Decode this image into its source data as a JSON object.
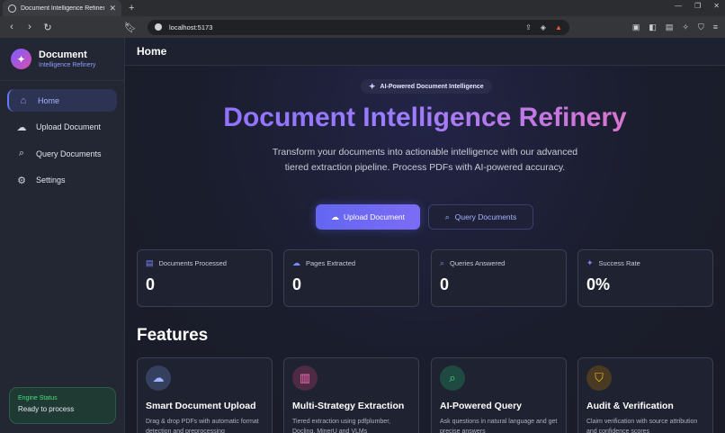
{
  "browser": {
    "tab_title": "Document Intelligence Refinery",
    "url": "localhost:5173"
  },
  "sidebar": {
    "brand_title": "Document",
    "brand_subtitle": "Intelligence Refinery",
    "items": [
      {
        "label": "Home",
        "icon": "home-icon",
        "active": true
      },
      {
        "label": "Upload Document",
        "icon": "cloud-upload-icon",
        "active": false
      },
      {
        "label": "Query Documents",
        "icon": "search-icon",
        "active": false
      },
      {
        "label": "Settings",
        "icon": "gear-icon",
        "active": false
      }
    ],
    "engine_status": {
      "title": "Engine Status",
      "value": "Ready to process"
    }
  },
  "header": {
    "title": "Home"
  },
  "hero": {
    "badge": "AI-Powered Document Intelligence",
    "title": "Document Intelligence Refinery",
    "subtitle": "Transform your documents into actionable intelligence with our advanced tiered extraction pipeline. Process PDFs with AI-powered accuracy.",
    "primary_button": "Upload Document",
    "secondary_button": "Query Documents"
  },
  "stats": [
    {
      "label": "Documents Processed",
      "value": "0",
      "icon": "document-icon"
    },
    {
      "label": "Pages Extracted",
      "value": "0",
      "icon": "cloud-icon"
    },
    {
      "label": "Queries Answered",
      "value": "0",
      "icon": "search-icon"
    },
    {
      "label": "Success Rate",
      "value": "0%",
      "icon": "sparkle-icon"
    }
  ],
  "features": {
    "title": "Features",
    "items": [
      {
        "title": "Smart Document Upload",
        "desc": "Drag & drop PDFs with automatic format detection and preprocessing",
        "icon": "cloud-upload-icon",
        "color": "#3b4a6b"
      },
      {
        "title": "Multi-Strategy Extraction",
        "desc": "Tiered extraction using pdfplumber, Docling, MinerU and VLMs",
        "icon": "chart-icon",
        "color": "#5a2a48"
      },
      {
        "title": "AI-Powered Query",
        "desc": "Ask questions in natural language and get precise answers",
        "icon": "search-icon",
        "color": "#1f4a42"
      },
      {
        "title": "Audit & Verification",
        "desc": "Claim verification with source attribution and confidence scores",
        "icon": "shield-icon",
        "color": "#4a3a1f"
      }
    ]
  },
  "colors": {
    "accent": "#6366f1",
    "success": "#4ade80"
  }
}
